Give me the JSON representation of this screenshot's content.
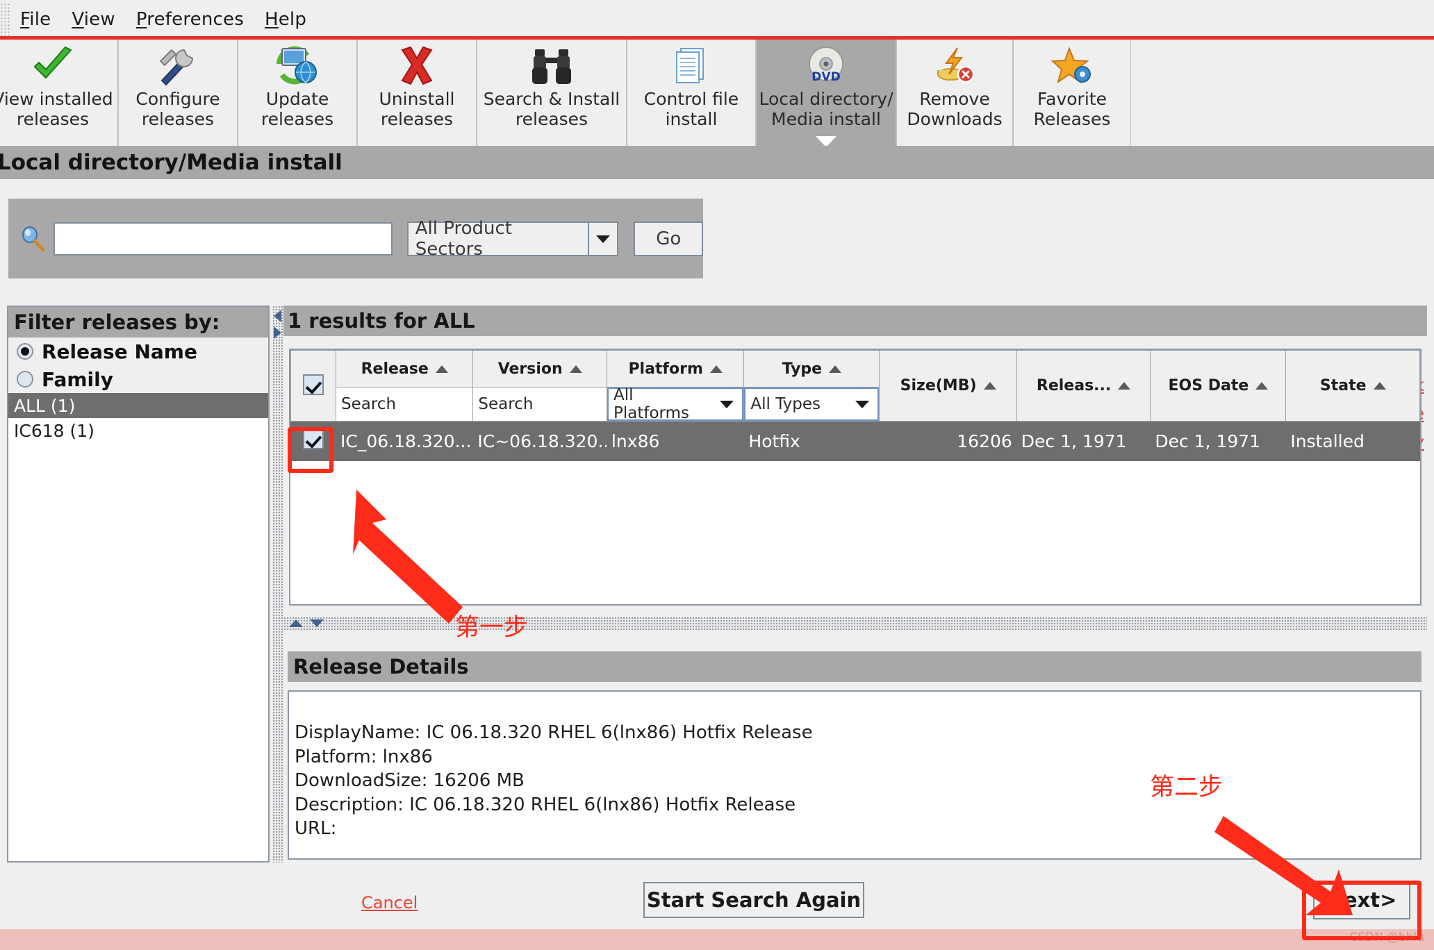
{
  "menubar": {
    "items": [
      {
        "name": "file",
        "label": "File",
        "mnemonic": "F"
      },
      {
        "name": "view",
        "label": "View",
        "mnemonic": "V"
      },
      {
        "name": "preferences",
        "label": "Preferences",
        "mnemonic": "P"
      },
      {
        "name": "help",
        "label": "Help",
        "mnemonic": "H"
      }
    ]
  },
  "toolbar": {
    "buttons": [
      {
        "name": "view-installed-releases",
        "label": "View installed\nreleases",
        "icon": "green-check-icon",
        "active": false
      },
      {
        "name": "configure-releases",
        "label": "Configure\nreleases",
        "icon": "wrench-screwdriver-icon",
        "active": false
      },
      {
        "name": "update-releases",
        "label": "Update\nreleases",
        "icon": "monitor-refresh-globe-icon",
        "active": false
      },
      {
        "name": "uninstall-releases",
        "label": "Uninstall\nreleases",
        "icon": "red-x-icon",
        "active": false
      },
      {
        "name": "search-install-releases",
        "label": "Search & Install\nreleases",
        "icon": "binoculars-icon",
        "active": false
      },
      {
        "name": "control-file-install",
        "label": "Control file\ninstall",
        "icon": "documents-icon",
        "active": false
      },
      {
        "name": "local-directory-media-install",
        "label": "Local directory/\nMedia install",
        "icon": "dvd-disc-icon",
        "active": true
      },
      {
        "name": "remove-downloads",
        "label": "Remove\nDownloads",
        "icon": "download-remove-icon",
        "active": false
      },
      {
        "name": "favorite-releases",
        "label": "Favorite\nReleases",
        "icon": "star-gear-icon",
        "active": false
      }
    ]
  },
  "page": {
    "title": "Local directory/Media install"
  },
  "search": {
    "icon": "magnifier-icon",
    "value": "",
    "placeholder": "",
    "sector_selected": "All Product Sectors",
    "sector_arrow_icon": "chevron-down-icon",
    "go_label": "Go"
  },
  "links": [
    {
      "name": "provide-feedback-link",
      "label": "Provide Feedback"
    },
    {
      "name": "server-downtime-link",
      "label": "Server Downtime"
    },
    {
      "name": "privacy-policy-link",
      "label": "Privacy Policy"
    }
  ],
  "filter": {
    "heading": "Filter releases by:",
    "radios": [
      {
        "name": "radio-release-name",
        "label": "Release Name",
        "selected": true
      },
      {
        "name": "radio-family",
        "label": "Family",
        "selected": false
      }
    ],
    "items": [
      {
        "name": "filter-item-all",
        "label": "ALL (1)",
        "selected": true
      },
      {
        "name": "filter-item-ic618",
        "label": "IC618 (1)",
        "selected": false
      }
    ]
  },
  "results": {
    "heading": "1 results for ALL",
    "header_checkbox_checked": true,
    "columns": [
      {
        "name": "col-release",
        "label": "Release",
        "sort": "asc"
      },
      {
        "name": "col-version",
        "label": "Version",
        "sort": "asc"
      },
      {
        "name": "col-platform",
        "label": "Platform",
        "sort": "asc"
      },
      {
        "name": "col-type",
        "label": "Type",
        "sort": "asc"
      },
      {
        "name": "col-size",
        "label": "Size(MB)",
        "sort": "asc"
      },
      {
        "name": "col-release-date",
        "label": "Releas...",
        "sort": "asc"
      },
      {
        "name": "col-eos-date",
        "label": "EOS Date",
        "sort": "asc"
      },
      {
        "name": "col-state",
        "label": "State",
        "sort": "asc"
      }
    ],
    "filters": {
      "release": "Search",
      "version": "Search",
      "platform": "All Platforms",
      "type": "All Types"
    },
    "rows": [
      {
        "checked": true,
        "release": "IC_06.18.320...",
        "version": "IC~06.18.320...",
        "platform": "lnx86",
        "type": "Hotfix",
        "size": "16206",
        "release_date": "Dec 1, 1971",
        "eos_date": "Dec 1, 1971",
        "state": "Installed"
      }
    ]
  },
  "details": {
    "heading": "Release Details",
    "lines": [
      "DisplayName: IC 06.18.320 RHEL 6(lnx86) Hotfix Release",
      "Platform: lnx86",
      "DownloadSize: 16206 MB",
      "Description: IC 06.18.320 RHEL 6(lnx86) Hotfix Release",
      "URL:"
    ]
  },
  "footer": {
    "cancel_label": "Cancel",
    "start_search_again_label": "Start Search Again",
    "next_label": "Next>",
    "watermark": "CSDN @bhlu"
  },
  "annotations": [
    {
      "name": "annotation-step-one",
      "label": "第一步"
    },
    {
      "name": "annotation-step-two",
      "label": "第二步"
    }
  ],
  "colors": {
    "accent_red": "#e03127",
    "link_red": "#e8433b",
    "annotation_red": "#fd2b1a",
    "band_gray": "#a8a8a8",
    "selection_gray": "#6e6e6e",
    "window_bg": "#efefef"
  }
}
